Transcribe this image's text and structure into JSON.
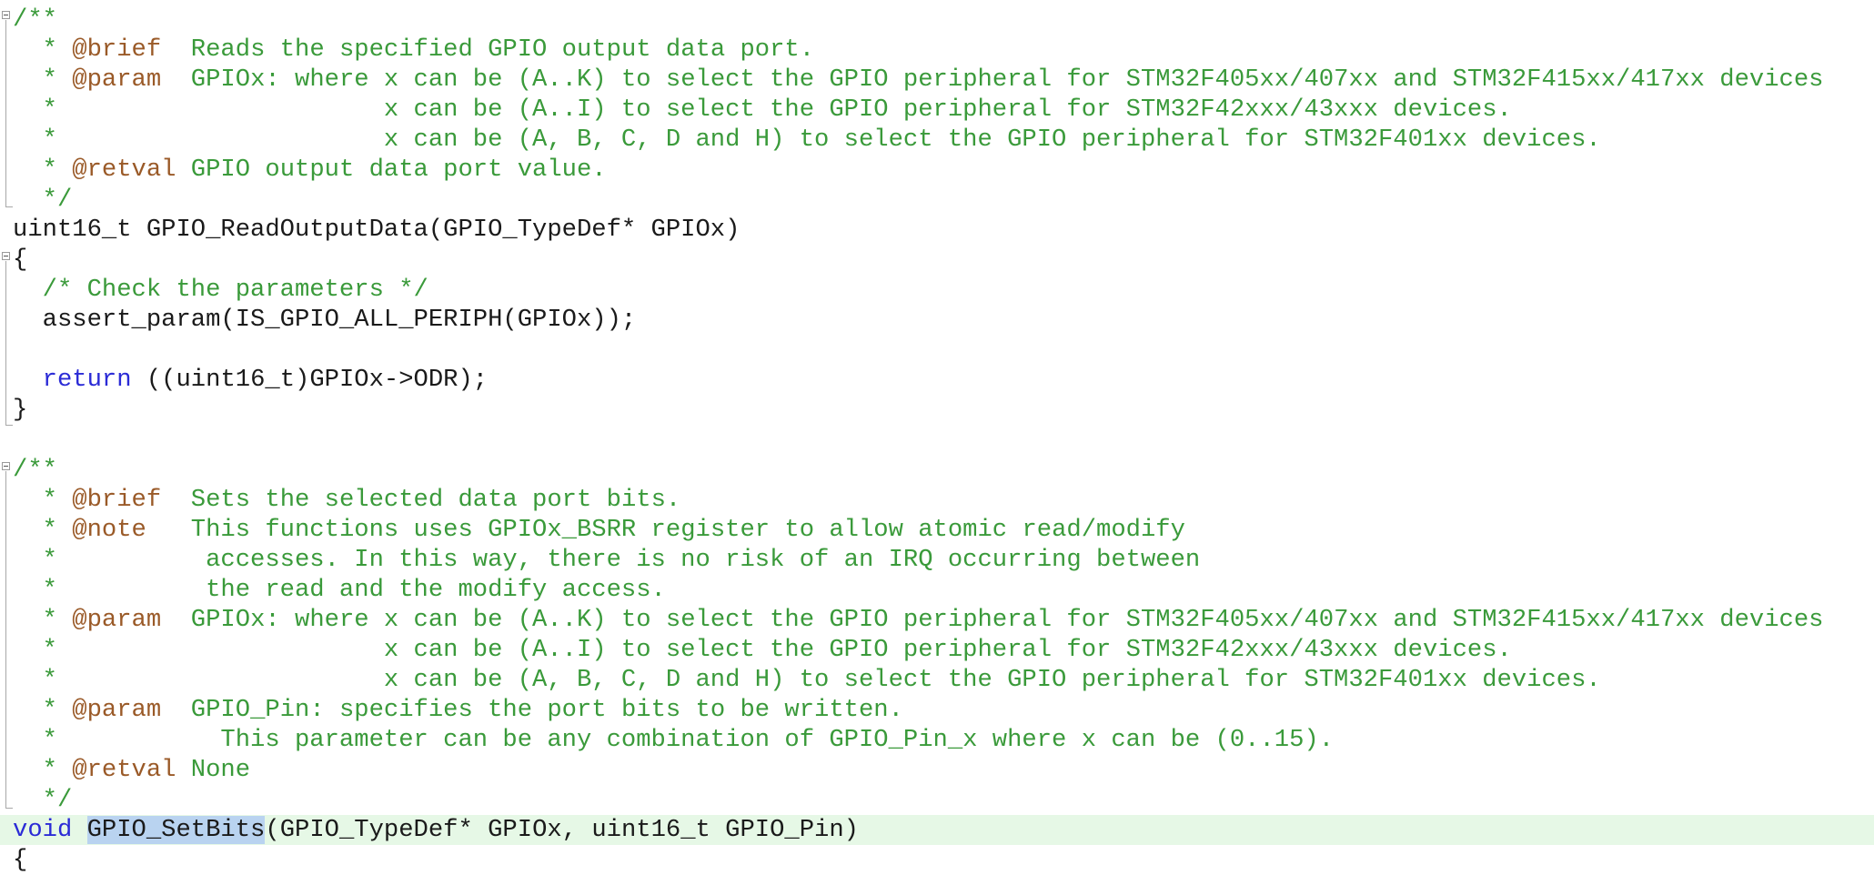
{
  "code": {
    "l01": "/**",
    "l02_pre": "  * ",
    "l02_tag": "@brief",
    "l02_text": "  Reads the specified GPIO output data port.",
    "l03_pre": "  * ",
    "l03_tag": "@param",
    "l03_text": "  GPIOx: where x can be (A..K) to select the GPIO peripheral for STM32F405xx/407xx and STM32F415xx/417xx devices",
    "l04": "  *                      x can be (A..I) to select the GPIO peripheral for STM32F42xxx/43xxx devices.",
    "l05": "  *                      x can be (A, B, C, D and H) to select the GPIO peripheral for STM32F401xx devices.",
    "l06_pre": "  * ",
    "l06_tag": "@retval",
    "l06_text": " GPIO output data port value.",
    "l07": "  */",
    "l08": "uint16_t GPIO_ReadOutputData(GPIO_TypeDef* GPIOx)",
    "l09": "{",
    "l10": "  /* Check the parameters */",
    "l11": "  assert_param(IS_GPIO_ALL_PERIPH(GPIOx));",
    "l12": "",
    "l13_kw": "return",
    "l13_text": " ((uint16_t)GPIOx->ODR);",
    "l14": "}",
    "l15": "",
    "l16": "/**",
    "l17_pre": "  * ",
    "l17_tag": "@brief",
    "l17_text": "  Sets the selected data port bits.",
    "l18_pre": "  * ",
    "l18_tag": "@note",
    "l18_text": "   This functions uses GPIOx_BSRR register to allow atomic read/modify",
    "l19": "  *          accesses. In this way, there is no risk of an IRQ occurring between",
    "l20": "  *          the read and the modify access.",
    "l21_pre": "  * ",
    "l21_tag": "@param",
    "l21_text": "  GPIOx: where x can be (A..K) to select the GPIO peripheral for STM32F405xx/407xx and STM32F415xx/417xx devices",
    "l22": "  *                      x can be (A..I) to select the GPIO peripheral for STM32F42xxx/43xxx devices.",
    "l23": "  *                      x can be (A, B, C, D and H) to select the GPIO peripheral for STM32F401xx devices.",
    "l24_pre": "  * ",
    "l24_tag": "@param",
    "l24_text": "  GPIO_Pin: specifies the port bits to be written.",
    "l25": "  *           This parameter can be any combination of GPIO_Pin_x where x can be (0..15).",
    "l26_pre": "  * ",
    "l26_tag": "@retval",
    "l26_text": " None",
    "l27": "  */",
    "l28_kw": "void",
    "l28_sel": "GPIO_SetBits",
    "l28_text": "(GPIO_TypeDef* GPIOx, uint16_t GPIO_Pin)",
    "l29": "{"
  }
}
